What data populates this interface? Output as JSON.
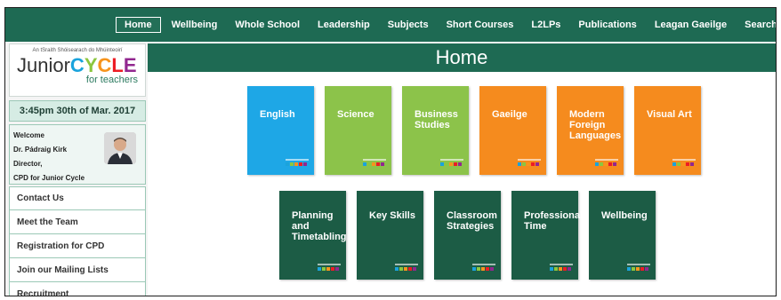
{
  "nav": {
    "items": [
      "Home",
      "Wellbeing",
      "Whole School",
      "Leadership",
      "Subjects",
      "Short Courses",
      "L2LPs",
      "Publications",
      "Leagan Gaeilge"
    ],
    "search_label": "Search"
  },
  "logo": {
    "irish": "An tSraith Shóisearach do Mhúinteoirí",
    "junior": "Junior",
    "cycle_letters": [
      "C",
      "Y",
      "C",
      "L",
      "E"
    ],
    "sub": "for teachers"
  },
  "date": "3:45pm  30th of Mar. 2017",
  "welcome": {
    "greeting": "Welcome",
    "name": "Dr. Pádraig Kirk",
    "title": "Director,",
    "org": "CPD for Junior Cycle"
  },
  "menu": [
    "Contact Us",
    "Meet the Team",
    "Registration for CPD",
    "Join our Mailing Lists",
    "Recruitment"
  ],
  "main": {
    "title": "Home"
  },
  "tiles_row1": [
    {
      "label": "English",
      "color": "blue"
    },
    {
      "label": "Science",
      "color": "green"
    },
    {
      "label": "Business Studies",
      "color": "green"
    },
    {
      "label": "Gaeilge",
      "color": "orange"
    },
    {
      "label": "Modern Foreign Languages",
      "color": "orange"
    },
    {
      "label": "Visual Art",
      "color": "orange"
    }
  ],
  "tiles_row2": [
    {
      "label": "Planning and Timetabling",
      "color": "dark"
    },
    {
      "label": "Key Skills",
      "color": "dark"
    },
    {
      "label": "Classroom Strategies",
      "color": "dark"
    },
    {
      "label": "Professional Time",
      "color": "dark"
    },
    {
      "label": "Wellbeing",
      "color": "dark"
    }
  ],
  "colors": {
    "nav": "#1e6a53",
    "blue": "#1ea7e6",
    "green": "#8cc34a",
    "orange": "#f58b1e",
    "dark": "#1c5c45"
  },
  "icons": {
    "search": "search-icon"
  }
}
